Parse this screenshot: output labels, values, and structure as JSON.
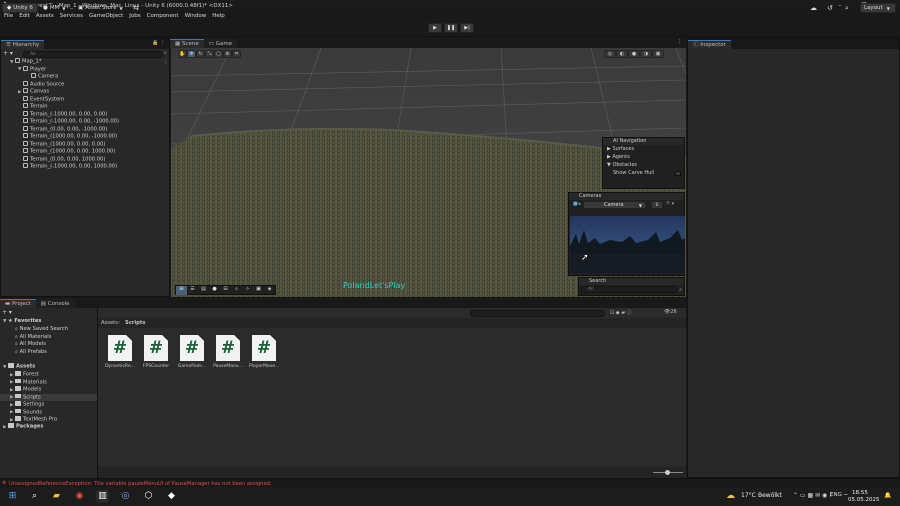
{
  "window": {
    "title": "Insane Forest™ - Map_1 - Windows, Mac, Linux - Unity 6 (6000.0.48f1)* <DX11>",
    "controls": [
      "–",
      "❐",
      "✕"
    ]
  },
  "menu": [
    "File",
    "Edit",
    "Assets",
    "Services",
    "GameObject",
    "Jobs",
    "Component",
    "Window",
    "Help"
  ],
  "toolbar": {
    "account": "Unity 6",
    "user": "MM",
    "asset_store": "Asset Store",
    "layout": "Layout"
  },
  "hierarchy": {
    "tab": "Hierarchy",
    "search_placeholder": "All",
    "scene": "Map_1*",
    "items": [
      {
        "label": "Player",
        "depth": 1,
        "arrow": "▼"
      },
      {
        "label": "Camera",
        "depth": 2,
        "arrow": ""
      },
      {
        "label": "Audio Source",
        "depth": 1,
        "arrow": ""
      },
      {
        "label": "Canvas",
        "depth": 1,
        "arrow": "▶"
      },
      {
        "label": "EventSystem",
        "depth": 1,
        "arrow": ""
      },
      {
        "label": "Terrain",
        "depth": 1,
        "arrow": ""
      },
      {
        "label": "Terrain_(-1000.00, 0.00, 0.00)",
        "depth": 1,
        "arrow": ""
      },
      {
        "label": "Terrain_(-1000.00, 0.00, -1000.00)",
        "depth": 1,
        "arrow": ""
      },
      {
        "label": "Terrain_(0.00, 0.00, -1000.00)",
        "depth": 1,
        "arrow": ""
      },
      {
        "label": "Terrain_(1000.00, 0.00, -1000.00)",
        "depth": 1,
        "arrow": ""
      },
      {
        "label": "Terrain_(1000.00, 0.00, 0.00)",
        "depth": 1,
        "arrow": ""
      },
      {
        "label": "Terrain_(1000.00, 0.00, 1000.00)",
        "depth": 1,
        "arrow": ""
      },
      {
        "label": "Terrain_(0.00, 0.00, 1000.00)",
        "depth": 1,
        "arrow": ""
      },
      {
        "label": "Terrain_(-1000.00, 0.00, 1000.00)",
        "depth": 1,
        "arrow": ""
      }
    ]
  },
  "scene_view": {
    "tabs": [
      "Scene",
      "Game"
    ],
    "watermark": "PolandLet'sPlay",
    "ai_navigation": {
      "title": "AI Navigation",
      "items": [
        "Surfaces",
        "Agents",
        "Obstacles"
      ],
      "toggle_label": "Show Carve Hull"
    },
    "cameras": {
      "title": "Cameras",
      "selected": "Camera"
    },
    "search": {
      "title": "Search",
      "placeholder": "All"
    }
  },
  "inspector": {
    "tab": "Inspector"
  },
  "project": {
    "tabs": [
      "Project",
      "Console"
    ],
    "favorites_label": "Favorites",
    "favorites": [
      "New Saved Search",
      "All Materials",
      "All Models",
      "All Prefabs"
    ],
    "assets_label": "Assets",
    "folders": [
      "Forest",
      "Materials",
      "Models",
      "Scripts",
      "Settings",
      "Sounds",
      "TextMesh Pro"
    ],
    "packages_label": "Packages",
    "breadcrumb": [
      "Assets",
      "Scripts"
    ],
    "badge_count": "26",
    "files": [
      "DynamicRe...",
      "FPSCounter",
      "GamePads...",
      "PauseManu...",
      "PlayerMove..."
    ]
  },
  "status": {
    "error": "UnassignedReferenceException: The variable pauseMenuUI of PauseManager has not been assigned.",
    "color": "#e14b4b"
  },
  "taskbar": {
    "weather": "17°C",
    "weather_desc": "Bewölkt",
    "lang": "ENG",
    "time": "18:55",
    "date": "05.05.2025"
  }
}
